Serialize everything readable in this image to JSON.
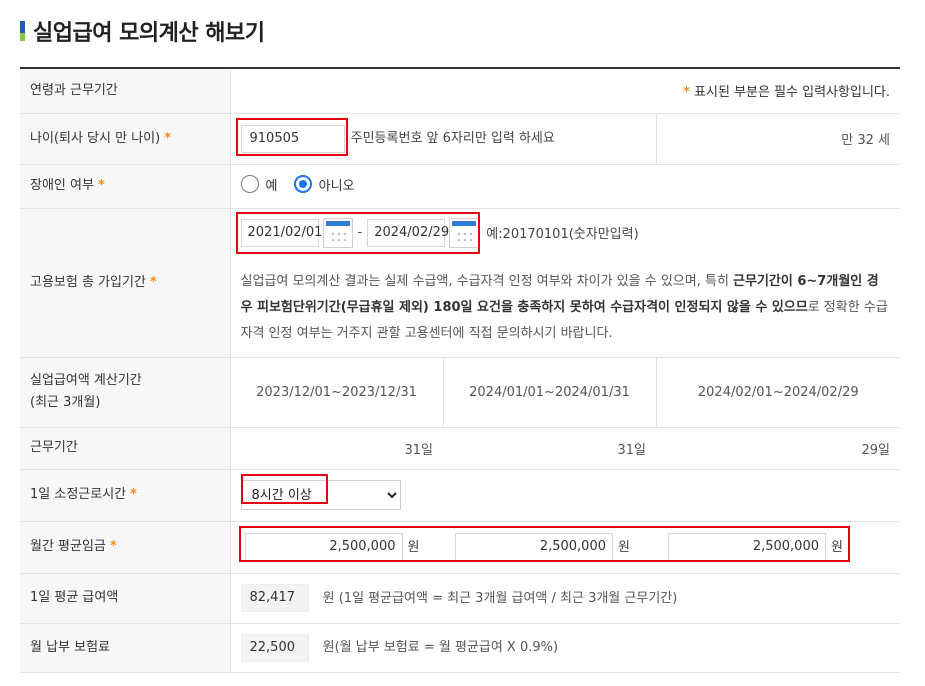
{
  "page": {
    "title": "실업급여 모의계산 해보기"
  },
  "header": {
    "label": "연령과 근무기간",
    "required_note": "표시된 부분은 필수 입력사항입니다.",
    "star": "*"
  },
  "age": {
    "label": "나이(퇴사 당시 만 나이)",
    "value": "910505",
    "hint": "주민등록번호 앞 6자리만 입력 하세요",
    "result": "만 32 세"
  },
  "disabled": {
    "label": "장애인 여부",
    "option_yes": "예",
    "option_no": "아니오",
    "selected": "아니오"
  },
  "insurance": {
    "label": "고용보험 총 가입기간",
    "start": "2021/02/01",
    "end": "2024/02/29",
    "separator": "-",
    "example": "예:20170101(숫자만입력)",
    "note_1": "실업급여 모의계산 결과는 실제 수급액, 수급자격 인정 여부와 차이가 있을 수 있으며, 특히 ",
    "note_bold_1": "근무기간이 6~7개월인 경우 피보험단위기간(무급휴일 제외) 180일 요건을 충족하지 못하여 수급자격이 인정되지 않을 수 있으므",
    "note_2": "로 정확한 수급자격 인정 여부는 거주지 관할 고용센터에 직접 문의하시기 바랍니다."
  },
  "calc_period": {
    "label_1": "실업급여액 계산기간",
    "label_2": "(최근 3개월)",
    "periods": [
      "2023/12/01~2023/12/31",
      "2024/01/01~2024/01/31",
      "2024/02/01~2024/02/29"
    ]
  },
  "work_days": {
    "label": "근무기간",
    "values": [
      "31일",
      "31일",
      "29일"
    ]
  },
  "daily_hours": {
    "label": "1일 소정근로시간",
    "selected": "8시간 이상"
  },
  "monthly_wage": {
    "label": "월간 평균임금",
    "values": [
      "2,500,000",
      "2,500,000",
      "2,500,000"
    ],
    "unit": "원"
  },
  "daily_avg": {
    "label": "1일 평균 급여액",
    "value": "82,417",
    "desc": "원 (1일 평균급여액 = 최근 3개월 급여액 / 최근 3개월 근무기간)"
  },
  "premium": {
    "label": "월 납부 보험료",
    "value": "22,500",
    "desc": "원(월 납부 보험료 = 월 평균급여 X 0.9%)"
  },
  "colors": {
    "accent": "#1a73e8",
    "required": "#f08c1e",
    "highlight": "#e60012"
  }
}
